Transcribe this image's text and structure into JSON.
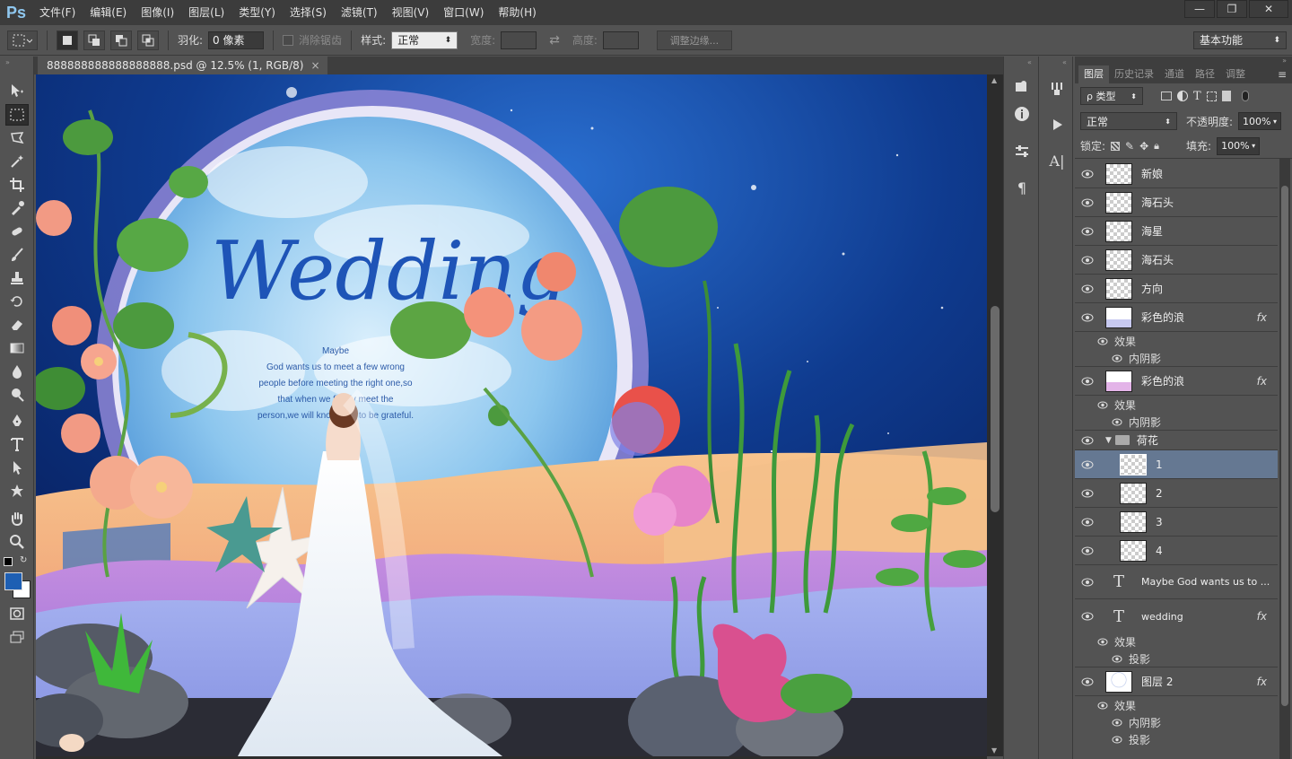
{
  "app": {
    "logo": "Ps"
  },
  "menu": {
    "items": [
      "文件(F)",
      "编辑(E)",
      "图像(I)",
      "图层(L)",
      "类型(Y)",
      "选择(S)",
      "滤镜(T)",
      "视图(V)",
      "窗口(W)",
      "帮助(H)"
    ]
  },
  "window_controls": {
    "minimize": "—",
    "restore": "❐",
    "close": "✕"
  },
  "options": {
    "feather_label": "羽化:",
    "feather_value": "0 像素",
    "antialias_label": "消除锯齿",
    "style_label": "样式:",
    "style_value": "正常",
    "width_label": "宽度:",
    "height_label": "高度:",
    "refine_button": "调整边缘...",
    "workspace": "基本功能"
  },
  "document": {
    "tab_title": "888888888888888888.psd @ 12.5% (1, RGB/8)",
    "close": "×"
  },
  "artwork": {
    "title": "Wedding",
    "lines": [
      "Maybe",
      "God wants us to meet a few wrong",
      "people before meeting the right one,so",
      "that when we finally meet the",
      "person,we will know how to be grateful."
    ]
  },
  "panel": {
    "tabs": [
      "图层",
      "历史记录",
      "通道",
      "路径",
      "调整"
    ],
    "filter_label": "ρ 类型",
    "blend_mode": "正常",
    "opacity_label": "不透明度:",
    "opacity_value": "100%",
    "lock_label": "锁定:",
    "fill_label": "填充:",
    "fill_value": "100%"
  },
  "layers": [
    {
      "name": "新娘",
      "type": "raster"
    },
    {
      "name": "海石头",
      "type": "raster"
    },
    {
      "name": "海星",
      "type": "raster"
    },
    {
      "name": "海石头",
      "type": "raster"
    },
    {
      "name": "方向",
      "type": "raster"
    },
    {
      "name": "彩色的浪",
      "type": "raster",
      "fx": "fx",
      "effects_label": "效果",
      "effects": [
        "内阴影"
      ]
    },
    {
      "name": "彩色的浪",
      "type": "raster",
      "fx": "fx",
      "effects_label": "效果",
      "effects": [
        "内阴影"
      ]
    },
    {
      "name": "荷花",
      "type": "group"
    },
    {
      "name": "1",
      "type": "raster",
      "selected": true,
      "indent": true
    },
    {
      "name": "2",
      "type": "raster",
      "indent": true
    },
    {
      "name": "3",
      "type": "raster",
      "indent": true
    },
    {
      "name": "4",
      "type": "raster",
      "indent": true
    },
    {
      "name": "Maybe  God wants us to ...",
      "type": "text"
    },
    {
      "name": "wedding",
      "type": "text",
      "fx": "fx",
      "effects_label": "效果",
      "effects": [
        "投影"
      ]
    },
    {
      "name": "图层 2",
      "type": "raster",
      "fx": "fx",
      "effects_label": "效果",
      "effects": [
        "内阴影",
        "投影"
      ]
    }
  ],
  "colors": {
    "bg": "#535353",
    "menubar": "#3c3c3c",
    "selected_layer": "#657892",
    "foreground": "#1e5fb3",
    "background": "#ffffff"
  }
}
